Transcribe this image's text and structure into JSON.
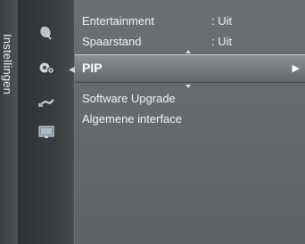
{
  "category": {
    "label": "Instellingen"
  },
  "menu": {
    "items": [
      {
        "label": "Entertainment",
        "value": ": Uit"
      },
      {
        "label": "Spaarstand",
        "value": ": Uit"
      },
      {
        "label": "PIP",
        "selected": true
      },
      {
        "label": "Software Upgrade"
      },
      {
        "label": "Algemene interface"
      }
    ]
  },
  "icons": [
    "satellite-dish-icon",
    "settings-gear-icon",
    "input-cable-icon",
    "tv-screen-icon"
  ],
  "colors": {
    "highlight": "#8a9094",
    "text": "#f4f4f4"
  }
}
